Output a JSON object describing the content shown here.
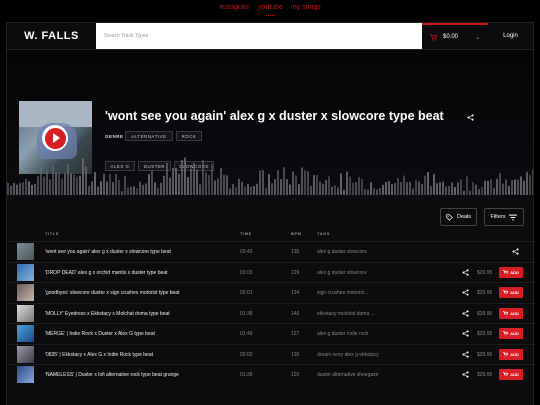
{
  "topnav": {
    "links": [
      "instagram",
      "youtube",
      "my songs"
    ]
  },
  "header": {
    "logo": "W. FALLS",
    "search_placeholder": "Search Track Types",
    "cart_total": "$0.00",
    "login_label": "Login"
  },
  "hero": {
    "title": "'wont see you again' alex g x duster x slowcore type beat",
    "genre_label": "GENRE",
    "genres": [
      "ALTERNATIVE",
      "ROCK"
    ],
    "tags": [
      "ALEX G",
      "DUSTER",
      "SLOWCORE"
    ]
  },
  "controls": {
    "deals_label": "Deals",
    "filters_label": "Filters"
  },
  "columns": {
    "title": "TITLE",
    "time": "TIME",
    "bpm": "BPM",
    "tags": "TAGS"
  },
  "tracks": [
    {
      "title": "'wont see you again' alex g x duster x slowcore type beat",
      "time": "03:43",
      "bpm": "135",
      "tags": "alex g  duster  slowcore",
      "price": "",
      "add_label": ""
    },
    {
      "title": "'DROP DEAD' alex g x orchid mantis x duster type beat",
      "time": "03:03",
      "bpm": "129",
      "tags": "alex g  duster  slowcore",
      "price": "$29.95",
      "add_label": "ADD"
    },
    {
      "title": "'goodbyes' slowcore duster x sign crushes motorist type beat",
      "time": "02:01",
      "bpm": "134",
      "tags": "sign crushes motorist ...",
      "price": "$29.95",
      "add_label": "ADD"
    },
    {
      "title": "'MOLLY' Eyedress x Ekkstacy x Molchat doma type beat",
      "time": "01:38",
      "bpm": "140",
      "tags": "ekkstacy  molchat doma ...",
      "price": "$29.95",
      "add_label": "ADD"
    },
    {
      "title": "'MERGE' | Indie Rock x Duster x Alex G type beat",
      "time": "01:49",
      "bpm": "127",
      "tags": "alex g  duster  indie rock",
      "price": "$29.95",
      "add_label": "ADD"
    },
    {
      "title": "'0835' | Ekkstacy x Alex G x Indie Rock type beat",
      "time": "02:00",
      "bpm": "135",
      "tags": "dream ivory  alex g  ekkstacy",
      "price": "$29.95",
      "add_label": "ADD"
    },
    {
      "title": "'NAMELESS' | Duster x lofi alternative rock type beat grunge",
      "time": "01:28",
      "bpm": "120",
      "tags": "duster  alternative  shoegaze",
      "price": "$29.95",
      "add_label": "ADD"
    }
  ],
  "colors": {
    "accent": "#d81e22",
    "background": "#000000",
    "panel": "#0c0c0e"
  },
  "icons": [
    "cart-icon",
    "chevron-down-icon",
    "play-icon",
    "share-icon",
    "tag-icon",
    "filter-icon"
  ]
}
